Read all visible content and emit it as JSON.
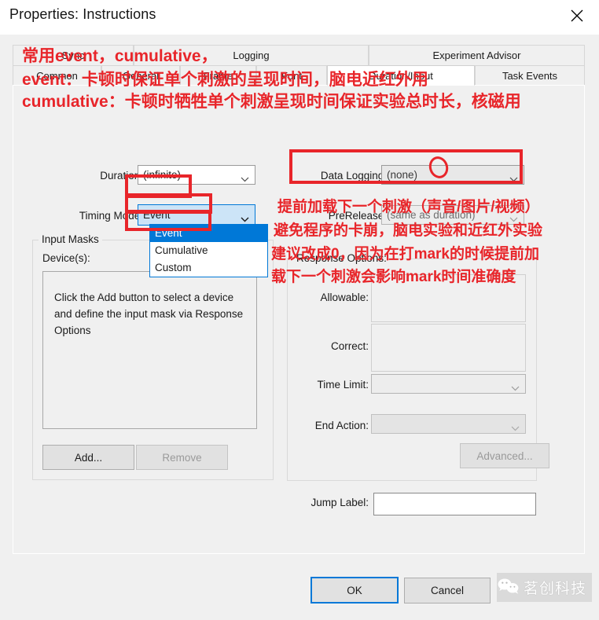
{
  "window": {
    "title": "Properties: Instructions",
    "close_icon": "close-icon"
  },
  "tabs": {
    "row1": [
      {
        "label": "Sync"
      },
      {
        "label": "Logging"
      },
      {
        "label": "Experiment Advisor"
      }
    ],
    "row2": [
      {
        "label": "Common"
      },
      {
        "label": "General"
      },
      {
        "label": "Frame"
      },
      {
        "label": "Font"
      },
      {
        "label": "Duration/Input",
        "active": true
      },
      {
        "label": "Task Events"
      }
    ]
  },
  "form": {
    "duration_label": "Duration:",
    "duration_value": "(infinite)",
    "timing_mode_label": "Timing Mode:",
    "timing_mode_value": "Event",
    "data_logging_label": "Data Logging:",
    "data_logging_value": "(none)",
    "prerelease_label": "PreRelease:",
    "prerelease_value": "(same as duration)"
  },
  "timing_dropdown": {
    "options": [
      "Event",
      "Cumulative",
      "Custom"
    ],
    "selected": "Event"
  },
  "input_masks": {
    "group_title": "Input Masks",
    "devices_label": "Device(s):",
    "empty_hint": "Click the Add button to select a device and define the input mask via Response Options",
    "add_label": "Add...",
    "remove_label": "Remove"
  },
  "response_options": {
    "group_title": "Response Options:",
    "allowable_label": "Allowable:",
    "allowable_value": "",
    "correct_label": "Correct:",
    "correct_value": "",
    "time_limit_label": "Time Limit:",
    "time_limit_value": "",
    "end_action_label": "End Action:",
    "end_action_value": "",
    "advanced_label": "Advanced..."
  },
  "jump": {
    "label": "Jump Label:",
    "value": ""
  },
  "footer": {
    "ok_label": "OK",
    "cancel_label": "Cancel"
  },
  "annotations": {
    "line1": "常用event，cumulative，",
    "line2": "event：卡顿时保证单个刺激的呈现时间，脑电近红外用",
    "line3": "cumulative：卡顿时牺牲单个刺激呈现时间保证实验总时长，核磁用",
    "right1": "提前加载下一个刺激（声音/图片/视频）",
    "right2": "避免程序的卡崩，脑电实验和近红外实验",
    "right3": "建议改成0，因为在打mark的时候提前加",
    "right4": "载下一个刺激会影响mark时间准确度"
  },
  "watermark": {
    "text": "茗创科技",
    "icon": "wechat-icon"
  },
  "colors": {
    "annotation_red": "#e8252a",
    "accent_blue": "#0078d7",
    "dialog_bg": "#f0f0f0"
  }
}
